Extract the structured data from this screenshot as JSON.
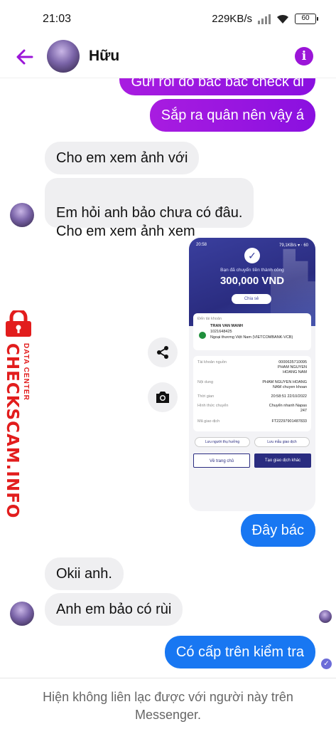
{
  "status_bar": {
    "time": "21:03",
    "net_speed": "229KB/s",
    "battery": "60"
  },
  "header": {
    "contact_name": "Hữu"
  },
  "messages": [
    {
      "text": "Gửi rồi đó bác bác check đi"
    },
    {
      "text": "Sắp ra quân nên vậy á"
    },
    {
      "text": "Cho em xem ảnh với"
    },
    {
      "text": "Em hỏi anh bảo chưa có đâu.\nCho em xem ảnh xem"
    },
    {
      "text": "Đây bác"
    },
    {
      "text": "Okii anh."
    },
    {
      "text": "Anh em bảo có rùi"
    },
    {
      "text": "Có cấp trên kiểm tra"
    }
  ],
  "receipt": {
    "time": "20:58",
    "status": "79,1KB/s ▾ ⋅ 60",
    "success_text": "Bạn đã chuyển tiền thành công",
    "amount": "300,000 VND",
    "share_label": "Chia sẻ",
    "to_label": "Đến tài khoản",
    "recipient_name": "TRAN VAN MANH",
    "recipient_account": "1021648425",
    "recipient_bank": "Ngoại thương Việt Nam (VIETCOMBANK-VCB)",
    "rows": [
      {
        "label": "Tài khoản nguồn",
        "value": "0000635710095\nPHAM NGUYEN\nHOANG NAM"
      },
      {
        "label": "Nội dung",
        "value": "PHAM NGUYEN HOANG\nNAM chuyen khoan"
      },
      {
        "label": "Thời gian",
        "value": "20:58:51 22/10/2022"
      },
      {
        "label": "Hình thức chuyển",
        "value": "Chuyển nhanh Napas\n247"
      },
      {
        "label": "Mã giao dịch",
        "value": "FT22297901487833"
      }
    ],
    "save_recipient": "Lưu người thụ hưởng",
    "save_template": "Lưu mẫu giao dịch",
    "home_button": "Về trang chủ",
    "new_transaction_button": "Tạo giao dịch khác"
  },
  "watermark": {
    "brand": "CHECKSCAM.INFO",
    "tagline": "DATA CENTER"
  },
  "footer": {
    "notice": "Hiện không liên lạc được với người này trên Messenger."
  },
  "colors": {
    "accent_purple": "#9b15d8",
    "bubble_blue": "#1877f2",
    "bubble_gray": "#efeff1",
    "watermark_red": "#e21d1d"
  }
}
